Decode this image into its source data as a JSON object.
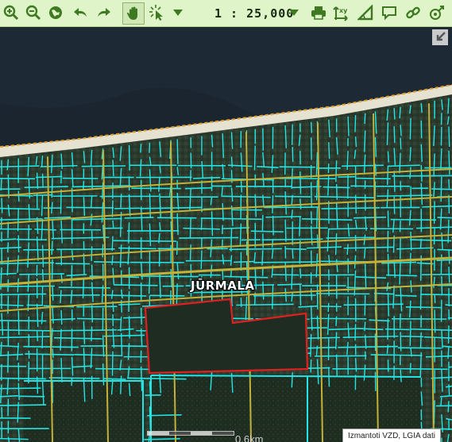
{
  "toolbar": {
    "scale": "1 : 25,000",
    "tools": [
      {
        "name": "zoom-in-icon"
      },
      {
        "name": "zoom-out-icon"
      },
      {
        "name": "globe-icon"
      },
      {
        "name": "undo-icon"
      },
      {
        "name": "redo-icon"
      },
      {
        "name": "pan-hand-icon"
      },
      {
        "name": "select-cursor-icon"
      },
      {
        "name": "dropdown-icon"
      },
      {
        "name": "scale-dropdown-icon"
      },
      {
        "name": "print-icon"
      },
      {
        "name": "coordinates-icon"
      },
      {
        "name": "measure-icon"
      },
      {
        "name": "comment-icon"
      },
      {
        "name": "link-icon"
      },
      {
        "name": "location-icon"
      }
    ]
  },
  "map": {
    "place_label": "JŪRMALA",
    "scalebar_label": "0.6km",
    "attribution": "Izmantoti VZD, LGIA dati",
    "colors": {
      "parcel_lines": "#22e6e6",
      "road_lines": "#c2b23a",
      "selected_parcel": "#e02020",
      "sea": "#1a2530",
      "beach": "#e6e2d2"
    }
  }
}
